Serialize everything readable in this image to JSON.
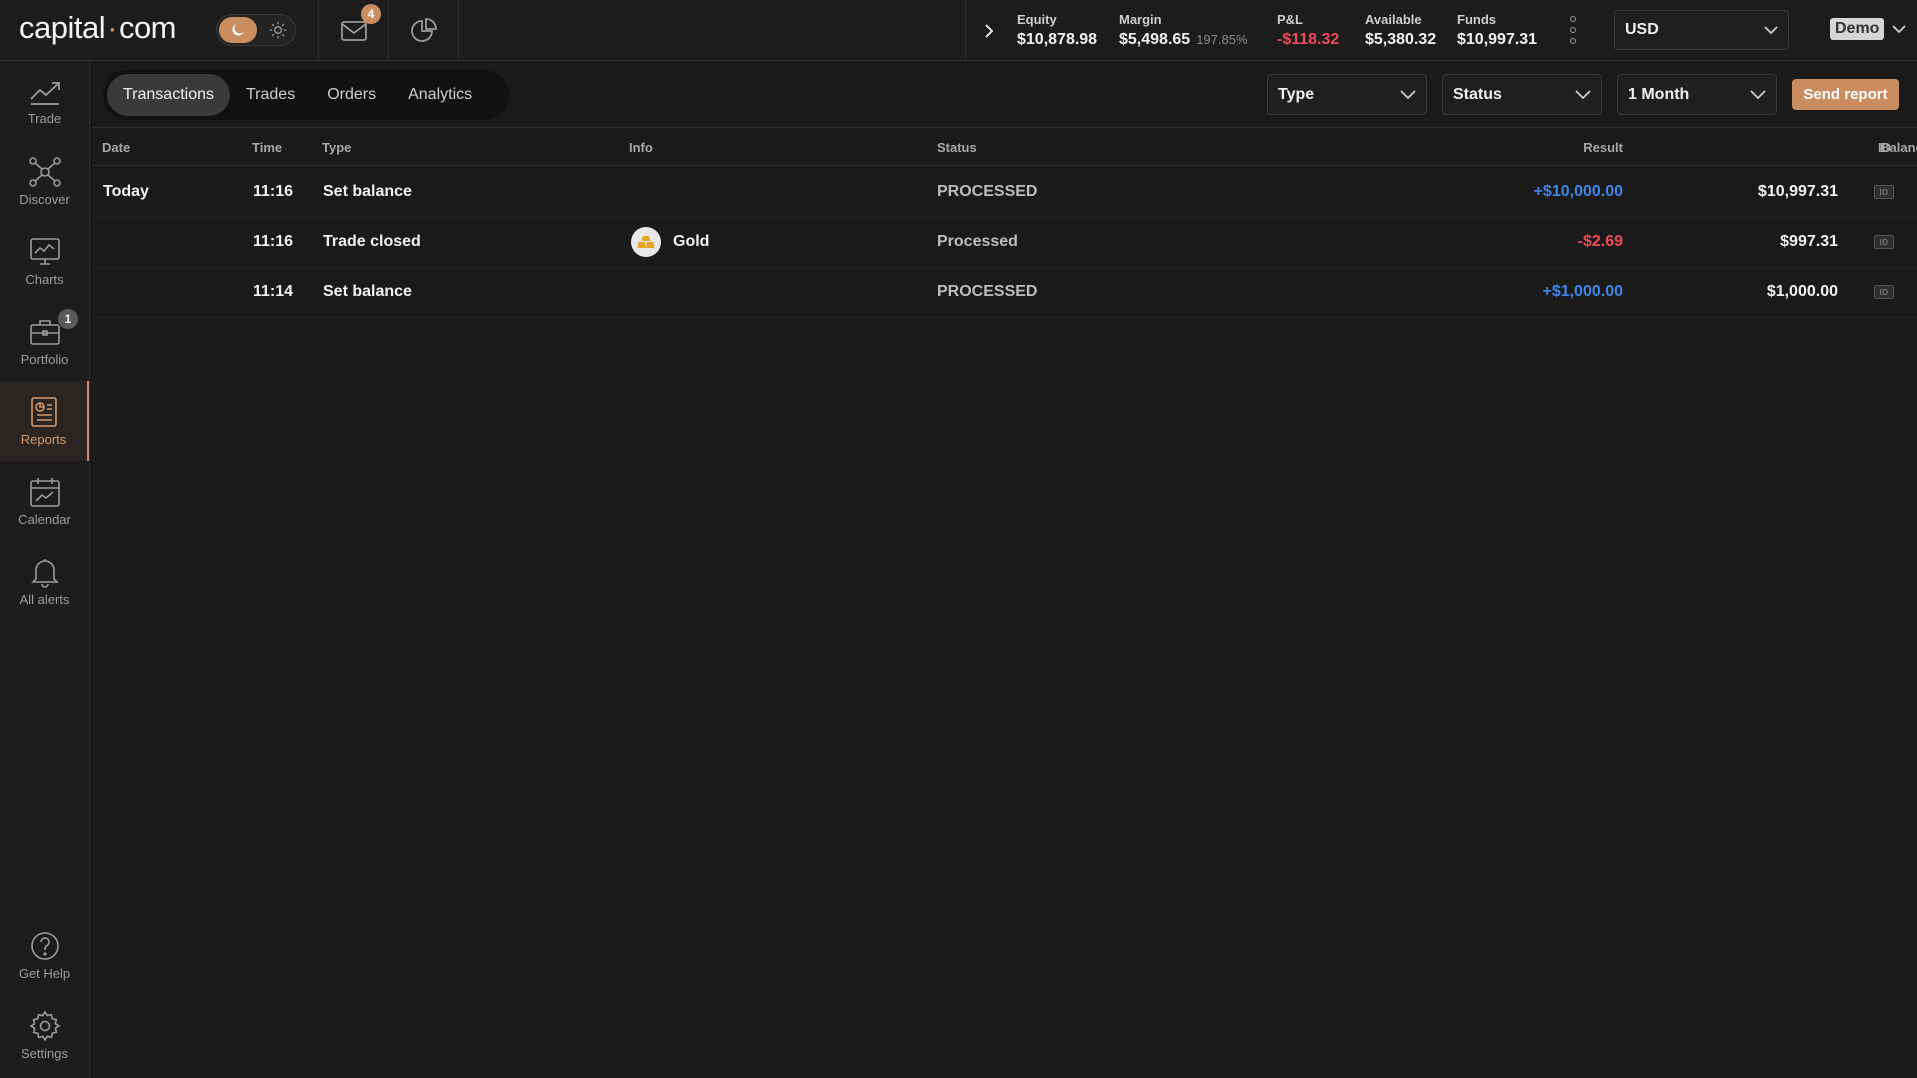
{
  "header": {
    "logo_left": "capital",
    "logo_dot": "·",
    "logo_right": "com",
    "mail_count": "4",
    "stats": {
      "equity_label": "Equity",
      "equity_value": "$10,878.98",
      "margin_label": "Margin",
      "margin_value": "$5,498.65",
      "margin_pct": "197.85%",
      "pnl_label": "P&L",
      "pnl_value": "-$118.32",
      "available_label": "Available",
      "available_value": "$5,380.32",
      "funds_label": "Funds",
      "funds_value": "$10,997.31"
    },
    "currency": "USD",
    "account_mode": "Demo"
  },
  "sidebar": {
    "items": [
      {
        "label": "Trade"
      },
      {
        "label": "Discover"
      },
      {
        "label": "Charts"
      },
      {
        "label": "Portfolio",
        "badge": "1"
      },
      {
        "label": "Reports",
        "active": true
      },
      {
        "label": "Calendar"
      },
      {
        "label": "All alerts"
      }
    ],
    "bottom": [
      {
        "label": "Get Help"
      },
      {
        "label": "Settings"
      }
    ]
  },
  "tabs": [
    "Transactions",
    "Trades",
    "Orders",
    "Analytics"
  ],
  "filters": {
    "type": "Type",
    "status": "Status",
    "period": "1 Month",
    "send_report": "Send report"
  },
  "table": {
    "columns": [
      "Date",
      "Time",
      "Type",
      "Info",
      "Status",
      "Result",
      "Balance",
      "ID"
    ],
    "rows": [
      {
        "date": "Today",
        "time": "11:16",
        "type": "Set balance",
        "info": "",
        "status": "PROCESSED",
        "result": "+$10,000.00",
        "balance": "$10,997.31",
        "id_icon": "ID"
      },
      {
        "date": "",
        "time": "11:16",
        "type": "Trade closed",
        "info": "Gold",
        "status": "Processed",
        "result": "-$2.69",
        "balance": "$997.31",
        "id_icon": "ID"
      },
      {
        "date": "",
        "time": "11:14",
        "type": "Set balance",
        "info": "",
        "status": "PROCESSED",
        "result": "+$1,000.00",
        "balance": "$1,000.00",
        "id_icon": "ID"
      }
    ]
  },
  "colors": {
    "accent": "#c98d60",
    "positive": "#3f86e6",
    "negative": "#ef4a58",
    "background": "#1a1a1a"
  }
}
